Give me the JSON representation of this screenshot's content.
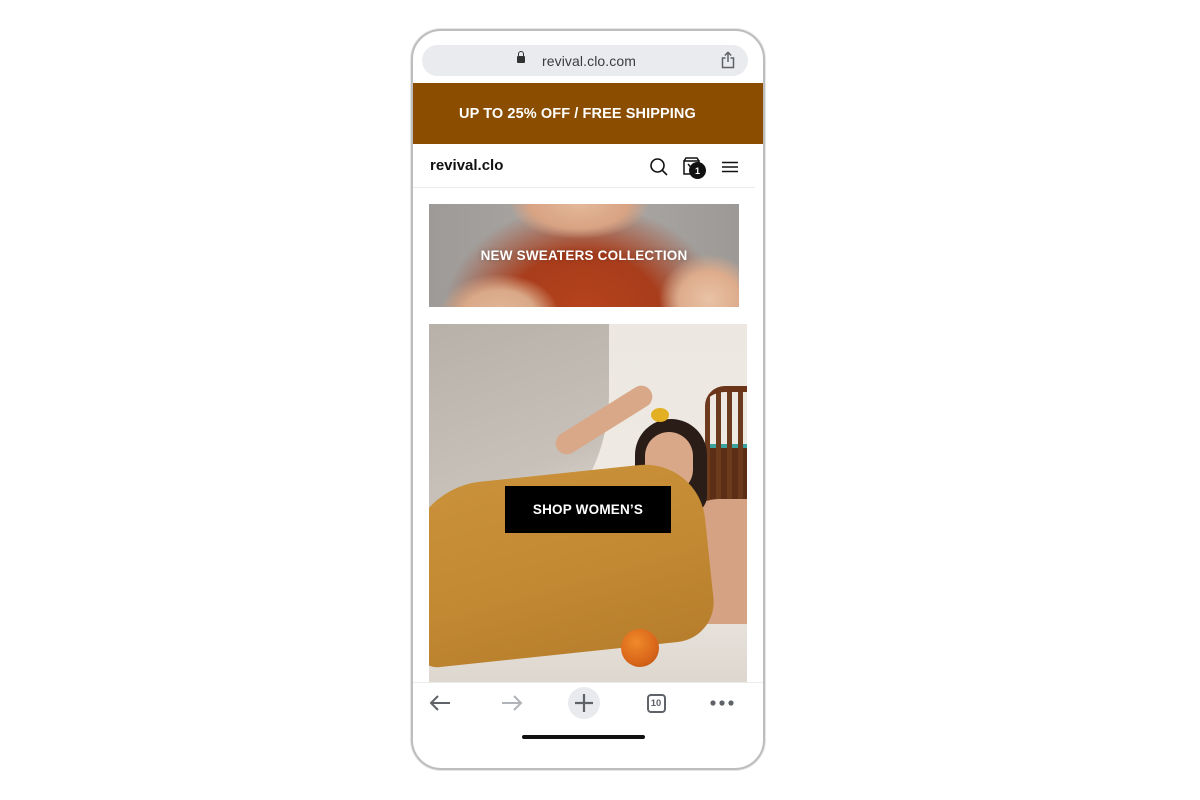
{
  "browser": {
    "url": "revival.clo.com",
    "icons": {
      "lock": "lock-icon",
      "share": "share-icon"
    }
  },
  "promo": {
    "text": "UP TO 25% OFF / FREE SHIPPING",
    "background": "#8b4d00"
  },
  "header": {
    "brand": "revival.clo",
    "cart_count": "1",
    "icons": {
      "search": "search-icon",
      "cart": "shopping-bag-icon",
      "menu": "hamburger-menu-icon"
    }
  },
  "banners": {
    "sweaters": {
      "title": "NEW SWEATERS COLLECTION"
    },
    "women": {
      "button_label": "SHOP WOMEN’S"
    }
  },
  "toolbar": {
    "tab_count": "10",
    "icons": {
      "back": "back-arrow-icon",
      "forward": "forward-arrow-icon",
      "new_tab": "plus-icon",
      "tabs": "tabs-icon",
      "more": "more-dots-icon"
    }
  }
}
